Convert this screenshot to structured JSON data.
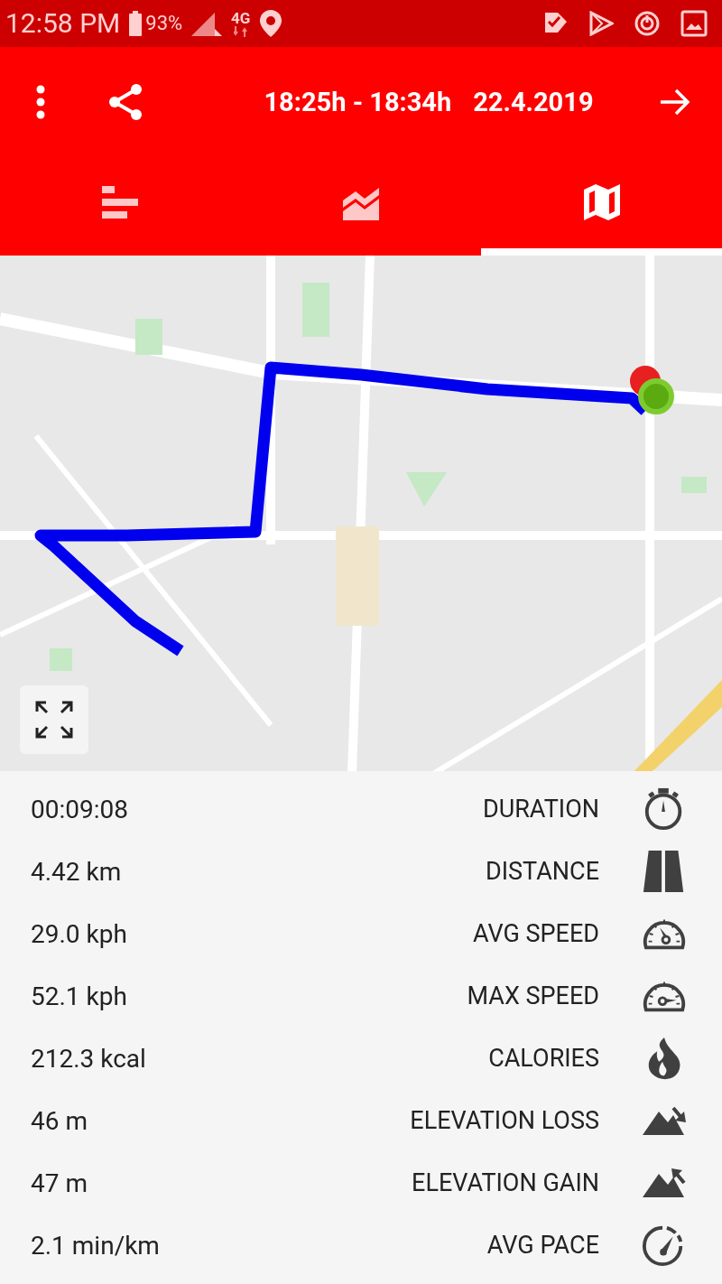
{
  "status_bar": {
    "time": "12:58 PM",
    "battery": "93%",
    "network": "4G"
  },
  "toolbar": {
    "time_range": "18:25h - 18:34h",
    "date": "22.4.2019"
  },
  "tabs": [
    {
      "kind": "summary",
      "selected": false
    },
    {
      "kind": "chart",
      "selected": false
    },
    {
      "kind": "map",
      "selected": true
    }
  ],
  "stats": [
    {
      "kind": "duration",
      "value": "00:09:08",
      "label": "DURATION"
    },
    {
      "kind": "distance",
      "value": "4.42 km",
      "label": "DISTANCE"
    },
    {
      "kind": "avg_speed",
      "value": "29.0 kph",
      "label": "AVG SPEED"
    },
    {
      "kind": "max_speed",
      "value": "52.1 kph",
      "label": "MAX SPEED"
    },
    {
      "kind": "calories",
      "value": "212.3 kcal",
      "label": "CALORIES"
    },
    {
      "kind": "elevation_loss",
      "value": "46 m",
      "label": "ELEVATION LOSS"
    },
    {
      "kind": "elevation_gain",
      "value": "47 m",
      "label": "ELEVATION GAIN"
    },
    {
      "kind": "pace",
      "value": "2.1 min/km",
      "label": "AVG PACE"
    }
  ]
}
